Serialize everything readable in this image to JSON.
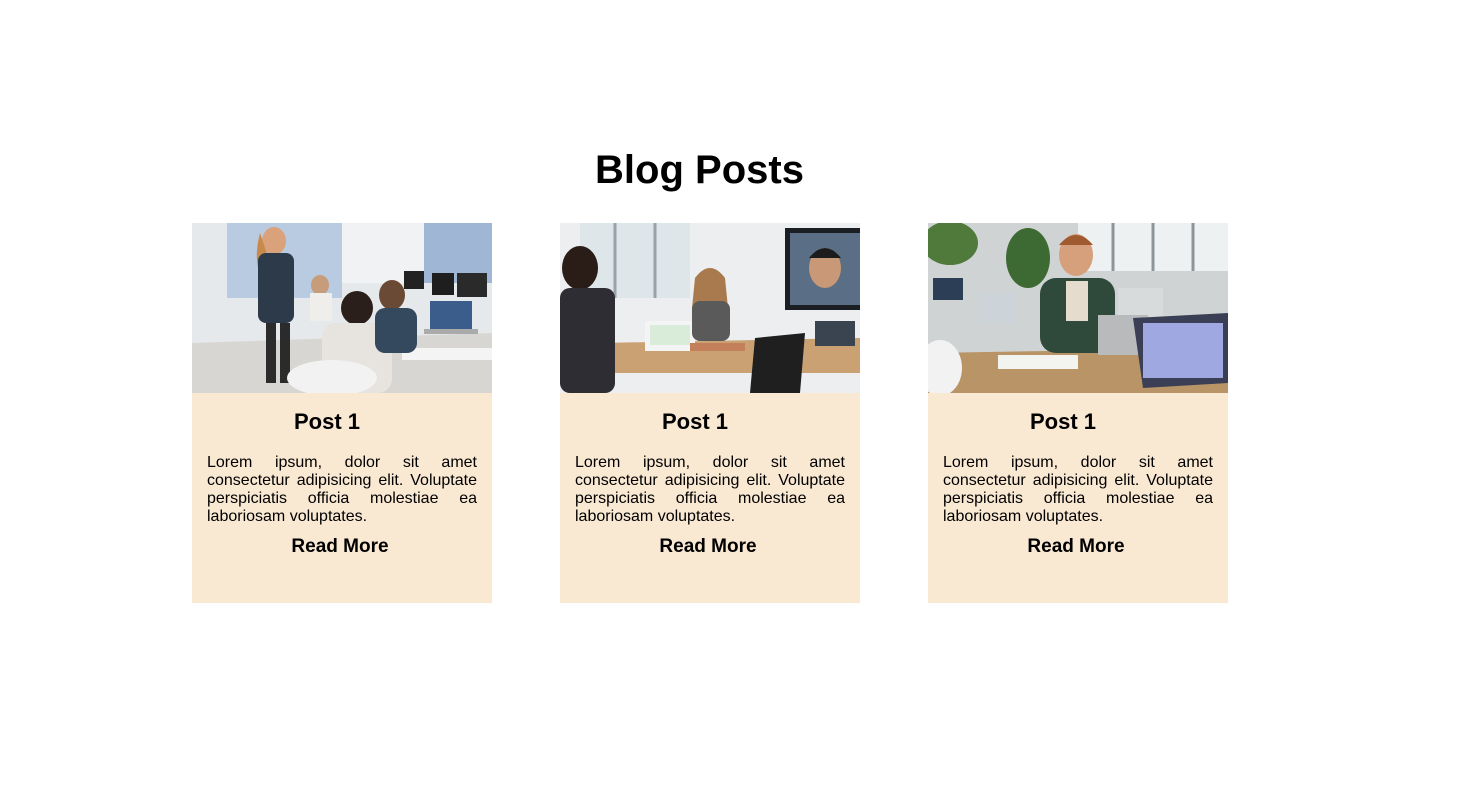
{
  "page": {
    "heading": "Blog Posts"
  },
  "colors": {
    "card_background": "#f9e8d2",
    "text": "#000000"
  },
  "posts": [
    {
      "title": "Post 1",
      "text": "Lorem ipsum, dolor sit amet consectetur adipisicing elit. Voluptate perspiciatis officia molestiae ea laboriosam voluptates.",
      "link_label": "Read More",
      "image_alt": "office-team-meeting-photo"
    },
    {
      "title": "Post 1",
      "text": "Lorem ipsum, dolor sit amet consectetur adipisicing elit. Voluptate perspiciatis officia molestiae ea laboriosam voluptates.",
      "link_label": "Read More",
      "image_alt": "conference-room-video-call-photo"
    },
    {
      "title": "Post 1",
      "text": "Lorem ipsum, dolor sit amet consectetur adipisicing elit. Voluptate perspiciatis officia molestiae ea laboriosam voluptates.",
      "link_label": "Read More",
      "image_alt": "man-at-laptop-office-photo"
    }
  ]
}
